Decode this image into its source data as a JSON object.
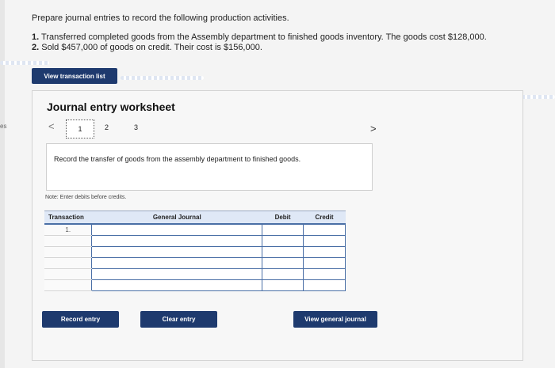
{
  "side_tab": "es",
  "prompt": "Prepare journal entries to record the following production activities.",
  "items": [
    {
      "num": "1.",
      "text": "Transferred completed goods from the Assembly department to finished goods inventory. The goods cost $128,000."
    },
    {
      "num": "2.",
      "text": "Sold $457,000 of goods on credit. Their cost is $156,000."
    }
  ],
  "view_list_label": "View transaction list",
  "worksheet": {
    "title": "Journal entry worksheet",
    "prev_arrow": "<",
    "next_arrow": ">",
    "steps": [
      "1",
      "2",
      "3"
    ],
    "instruction": "Record the transfer of goods from the assembly department to finished goods.",
    "note": "Note: Enter debits before credits."
  },
  "table": {
    "headers": [
      "Transaction",
      "General Journal",
      "Debit",
      "Credit"
    ],
    "first_transaction": "1."
  },
  "buttons": {
    "record": "Record entry",
    "clear": "Clear entry",
    "view_journal": "View general journal"
  }
}
